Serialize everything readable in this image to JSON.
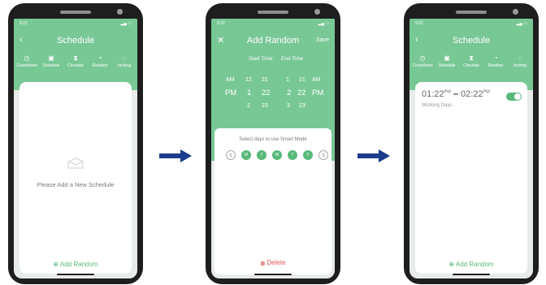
{
  "status_time": "9:22",
  "schedule_title": "Schedule",
  "tabs": [
    {
      "label": "Countdown",
      "icon": "clock-icon"
    },
    {
      "label": "Schedule",
      "icon": "calendar-icon"
    },
    {
      "label": "Circulate",
      "icon": "hourglass-icon"
    },
    {
      "label": "Random",
      "icon": "timer-icon"
    },
    {
      "label": "Inching",
      "icon": "pin-icon"
    }
  ],
  "screen1": {
    "empty_message": "Please Add a New Schedule",
    "add_label": "Add Random"
  },
  "screen2": {
    "title": "Add Random",
    "save_label": "Save",
    "start_label": "Start Time",
    "end_label": "End Time",
    "picker_rows": [
      [
        "AM",
        "12",
        "21",
        "1",
        "21",
        "AM"
      ],
      [
        "PM",
        "1",
        "22",
        "2",
        "22",
        "PM"
      ],
      [
        "",
        "2",
        "23",
        "3",
        "23",
        ""
      ]
    ],
    "days_prompt": "Select days to use Smart Mode",
    "days": [
      {
        "label": "S",
        "selected": false
      },
      {
        "label": "M",
        "selected": true
      },
      {
        "label": "T",
        "selected": true
      },
      {
        "label": "W",
        "selected": true
      },
      {
        "label": "T",
        "selected": true
      },
      {
        "label": "F",
        "selected": true
      },
      {
        "label": "S",
        "selected": false
      }
    ],
    "delete_label": "Delete"
  },
  "screen3": {
    "start_time": "01:22",
    "start_ampm": "PM",
    "dash": "–",
    "end_time": "02:22",
    "end_ampm": "PM",
    "days_label": "Working Days",
    "enabled": true,
    "add_label": "Add Random"
  },
  "colors": {
    "accent": "#78c895",
    "accent_dark": "#59b97a",
    "arrow": "#1c3c8c"
  }
}
